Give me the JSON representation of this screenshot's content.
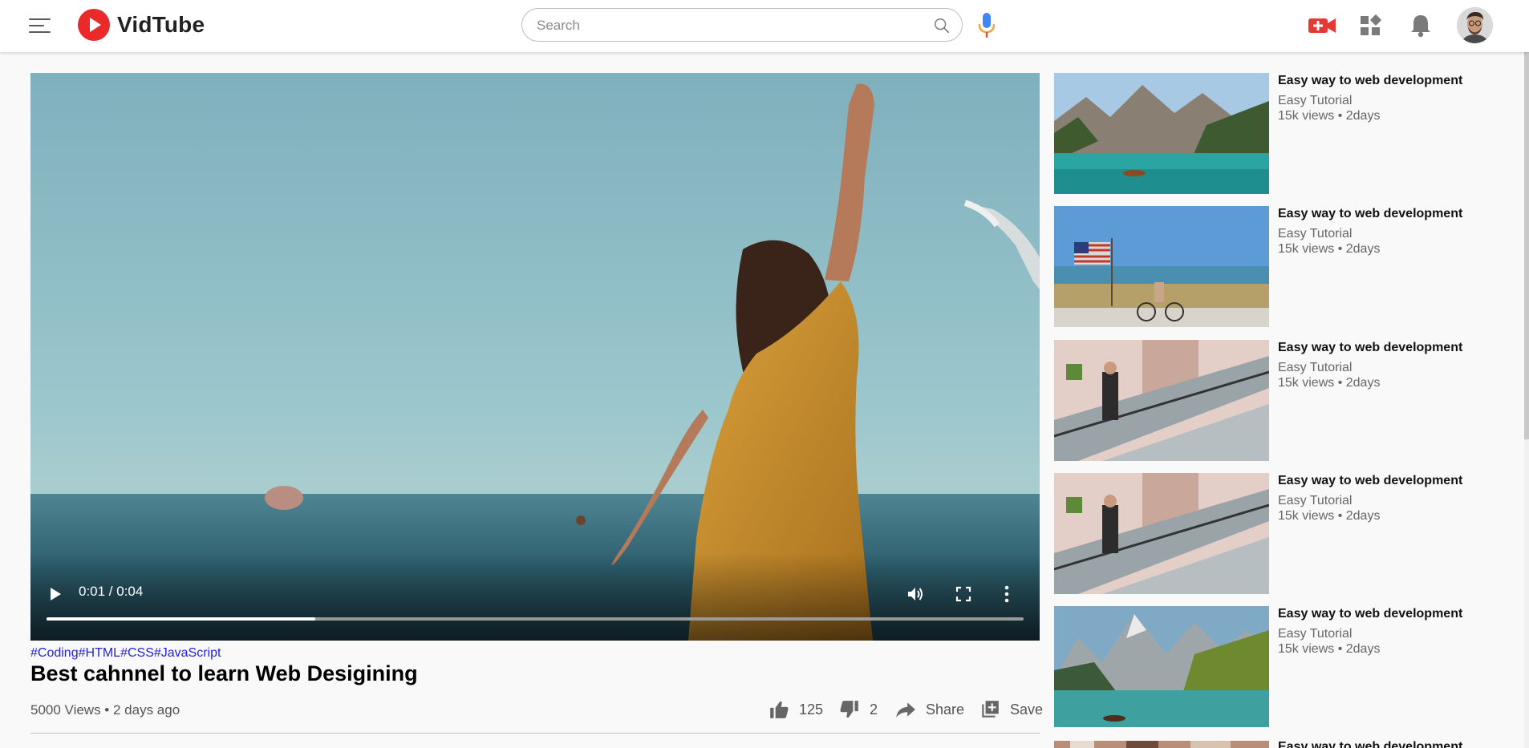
{
  "header": {
    "brand": "VidTube",
    "search_placeholder": "Search",
    "icons": {
      "menu": "hamburger-icon",
      "search": "search-icon",
      "mic": "mic-icon",
      "upload": "video-camera-icon",
      "apps": "apps-grid-icon",
      "notifications": "bell-icon"
    }
  },
  "colors": {
    "brand_red": "#ea2a2a",
    "tag_blue": "#2323d8",
    "mic_blue": "#4285f4"
  },
  "player": {
    "time_display": "0:01 / 0:04",
    "progress": 0.275
  },
  "video": {
    "tags": [
      "#Coding",
      "#HTML",
      "#CSS",
      "#JavaScript"
    ],
    "title": "Best cahnnel to learn Web Desigining",
    "views": "5000 Views • 2 days ago",
    "likes": "125",
    "dislikes": "2",
    "share_label": "Share",
    "save_label": "Save"
  },
  "sidebar": {
    "items": [
      {
        "title": "Easy way to web development",
        "channel": "Easy Tutorial",
        "meta": "15k views • 2days",
        "thumb": "mountain-lake"
      },
      {
        "title": "Easy way to web development",
        "channel": "Easy Tutorial",
        "meta": "15k views • 2days",
        "thumb": "beach-flag"
      },
      {
        "title": "Easy way to web development",
        "channel": "Easy Tutorial",
        "meta": "15k views • 2days",
        "thumb": "escalator"
      },
      {
        "title": "Easy way to web development",
        "channel": "Easy Tutorial",
        "meta": "15k views • 2days",
        "thumb": "escalator"
      },
      {
        "title": "Easy way to web development",
        "channel": "Easy Tutorial",
        "meta": "15k views • 2days",
        "thumb": "mountain-lake-2"
      },
      {
        "title": "Easy way to web development",
        "channel": "",
        "meta": "",
        "thumb": "street"
      }
    ]
  }
}
